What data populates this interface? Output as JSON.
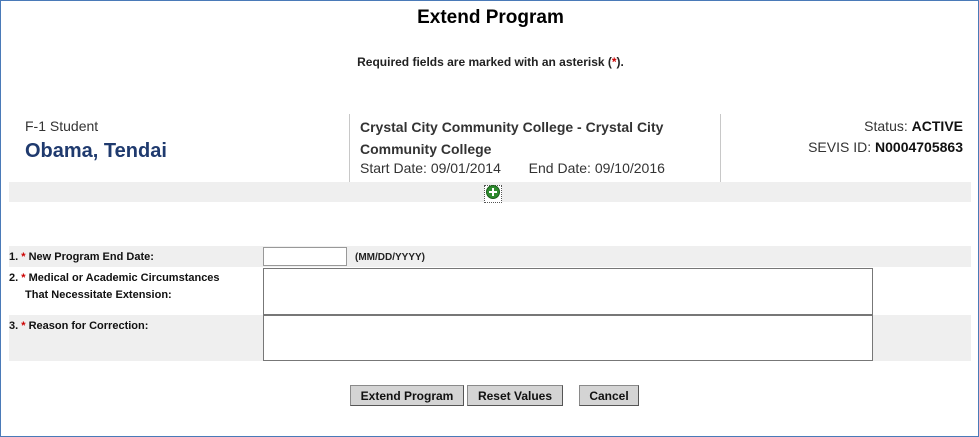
{
  "page": {
    "title": "Extend Program",
    "required_note_prefix": "Required fields are marked with an asterisk (",
    "required_note_asterisk": "*",
    "required_note_suffix": ")."
  },
  "student": {
    "visa_type": "F-1 Student",
    "name": "Obama, Tendai",
    "school": "Crystal City Community College - Crystal City Community College",
    "start_date_label": "Start Date:",
    "start_date": "09/01/2014",
    "end_date_label": "End Date:",
    "end_date": "09/10/2016",
    "status_label": "Status:",
    "status": "ACTIVE",
    "sevis_label": "SEVIS ID:",
    "sevis_id": "N0004705863"
  },
  "expand_icon": "plus-circle-icon",
  "form": {
    "field1": {
      "number": "1.",
      "required": "*",
      "label": "New Program End Date:",
      "value": "",
      "format_hint": "(MM/DD/YYYY)"
    },
    "field2": {
      "number": "2.",
      "required": "*",
      "label_line1": "Medical or Academic Circumstances",
      "label_line2": "That Necessitate Extension:",
      "value": ""
    },
    "field3": {
      "number": "3.",
      "required": "*",
      "label": "Reason for Correction:",
      "value": ""
    }
  },
  "buttons": {
    "extend": "Extend Program",
    "reset": "Reset Values",
    "cancel": "Cancel"
  },
  "colors": {
    "frame_border": "#4a7ab8",
    "name_blue": "#1f3a6e",
    "asterisk_red": "#cc0000",
    "expand_green": "#2e8b2e"
  }
}
